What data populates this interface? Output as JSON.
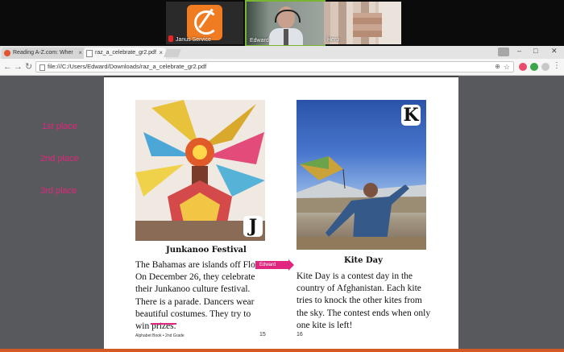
{
  "participants": [
    {
      "name": "Janus Service"
    },
    {
      "name": "Edward"
    },
    {
      "name": "Hero"
    }
  ],
  "browser": {
    "tabs": [
      {
        "title": "Reading A-Z.com: Wher"
      },
      {
        "title": "raz_a_celebrate_gr2.pdf"
      }
    ],
    "url": "file:///C:/Users/Edward/Downloads/raz_a_celebrate_gr2.pdf",
    "colors": {
      "accent": "#e0267e"
    }
  },
  "annotations": {
    "places": [
      "1st place",
      "2nd place",
      "3rd place"
    ],
    "arrow_label": "Edward"
  },
  "pages": {
    "left": {
      "badge": "J",
      "caption": "Junkanoo Festival",
      "text": "The Bahamas are islands off Florida. On December 26, they celebrate their Junkanoo culture festival. There is a parade. Dancers wear beautiful costumes. They try to win prizes.",
      "lines": [
        "The Bahamas are islands off Florida.",
        "On December 26, they celebrate",
        "their Junkanoo culture festival.",
        "There is a parade. Dancers wear",
        "beautiful costumes. They try to",
        "win prizes."
      ],
      "footer": "Alphabet Book • 2nd Grade",
      "page_number": "15"
    },
    "right": {
      "badge": "K",
      "caption": "Kite Day",
      "text": "Kite Day is a contest day in the country of Afghanistan. Each kite tries to knock the other kites from the sky. The contest ends when only one kite is left!",
      "lines": [
        "Kite Day is a contest day in the",
        "country of Afghanistan. Each kite",
        "tries to knock the other kites from",
        "the sky. The contest ends when only",
        "one kite is left!"
      ],
      "page_number": "16"
    }
  }
}
